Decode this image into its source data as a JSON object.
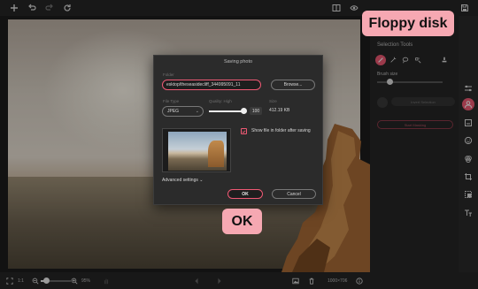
{
  "icons": {
    "new": "plus-icon",
    "undo": "undo-icon",
    "redo": "redo-icon",
    "reset": "reset-icon",
    "compare": "compare-icon",
    "preview": "eye-icon",
    "save": "floppy-disk-icon"
  },
  "right_panel": {
    "selection_tools_label": "Selection Tools",
    "brush_size_label": "Brush size",
    "brush_size": 0.15,
    "action_button_1": "Invert Selection",
    "action_button_2": "Start Masking"
  },
  "dialog": {
    "title": "Saving photo",
    "path_label": "Folder",
    "path_value": "esktop/theseasidecliff_344995091_11",
    "browse_label": "Browse...",
    "file_type_label": "File Type",
    "file_type_value": "JPEG",
    "quality_label": "Quality: High",
    "quality_value": "100",
    "size_label": "Size",
    "size_value": "412.19 KB",
    "show_in_folder_label": "Show file in folder after saving",
    "show_in_folder_checked": true,
    "advanced_settings": "Advanced settings",
    "ok_label": "OK",
    "cancel_label": "Cancel"
  },
  "bottom_bar": {
    "ratio": "1:1",
    "zoom": "95%",
    "dimensions": "1000×706"
  },
  "callouts": {
    "floppy": "Floppy disk",
    "ok": "OK"
  },
  "colors": {
    "accent": "#ef5974",
    "callout_bg": "#f6a8b2",
    "panel_bg": "#252525"
  }
}
